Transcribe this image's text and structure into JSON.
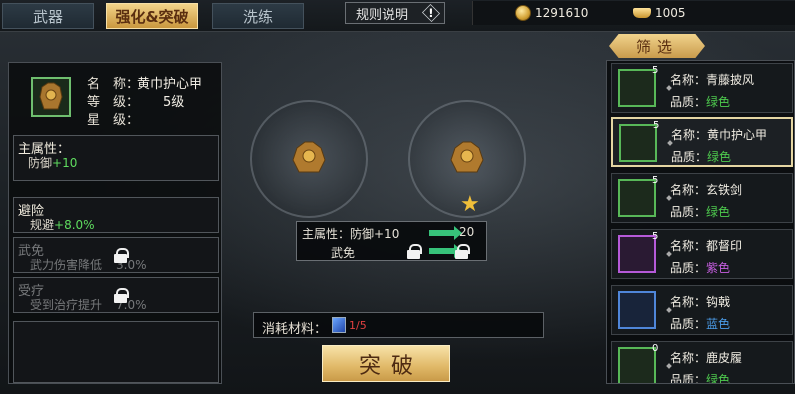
{
  "tabs": [
    {
      "label": "武器",
      "active": false
    },
    {
      "label": "强化&突破",
      "active": true
    },
    {
      "label": "洗练",
      "active": false
    }
  ],
  "rules_button": {
    "label": "规则说明",
    "icon": "exclamation-icon"
  },
  "currency": {
    "coins": "1291610",
    "ingots": "1005"
  },
  "equipment": {
    "name_label": "名　称：",
    "name": "黄巾护心甲",
    "level_label": "等　级：",
    "level": "5级",
    "star_label": "星　级："
  },
  "main_attr": {
    "title": "主属性：",
    "line_label": "防御",
    "line_value": "+10"
  },
  "dodge": {
    "title": "避险",
    "line_label": "规避",
    "line_value": "+8.0%"
  },
  "immune": {
    "title": "武免",
    "line": "武力伤害降低",
    "value": "3.0%"
  },
  "heal": {
    "title": "受疗",
    "line": "受到治疗提升",
    "value": "7.0%"
  },
  "compare": {
    "main_label": "主属性：防御+10",
    "main_after": "20",
    "sub_label": "武免"
  },
  "material": {
    "label": "消耗材料：",
    "count": "1/5"
  },
  "break_button": {
    "label": "突破"
  },
  "filter": {
    "label": "筛选"
  },
  "items": [
    {
      "level": "5",
      "name_label": "名称：",
      "name": "青藤披风",
      "quality_label": "品质：",
      "quality": "绿色",
      "q": "green"
    },
    {
      "level": "5",
      "name_label": "名称：",
      "name": "黄巾护心甲",
      "quality_label": "品质：",
      "quality": "绿色",
      "q": "green"
    },
    {
      "level": "5",
      "name_label": "名称：",
      "name": "玄铁剑",
      "quality_label": "品质：",
      "quality": "绿色",
      "q": "green"
    },
    {
      "level": "5",
      "name_label": "名称：",
      "name": "都督印",
      "quality_label": "品质：",
      "quality": "紫色",
      "q": "purple"
    },
    {
      "level": "",
      "name_label": "名称：",
      "name": "钩戟",
      "quality_label": "品质：",
      "quality": "蓝色",
      "q": "blue"
    },
    {
      "level": "0",
      "name_label": "名称：",
      "name": "鹿皮履",
      "quality_label": "品质：",
      "quality": "绿色",
      "q": "green"
    }
  ]
}
